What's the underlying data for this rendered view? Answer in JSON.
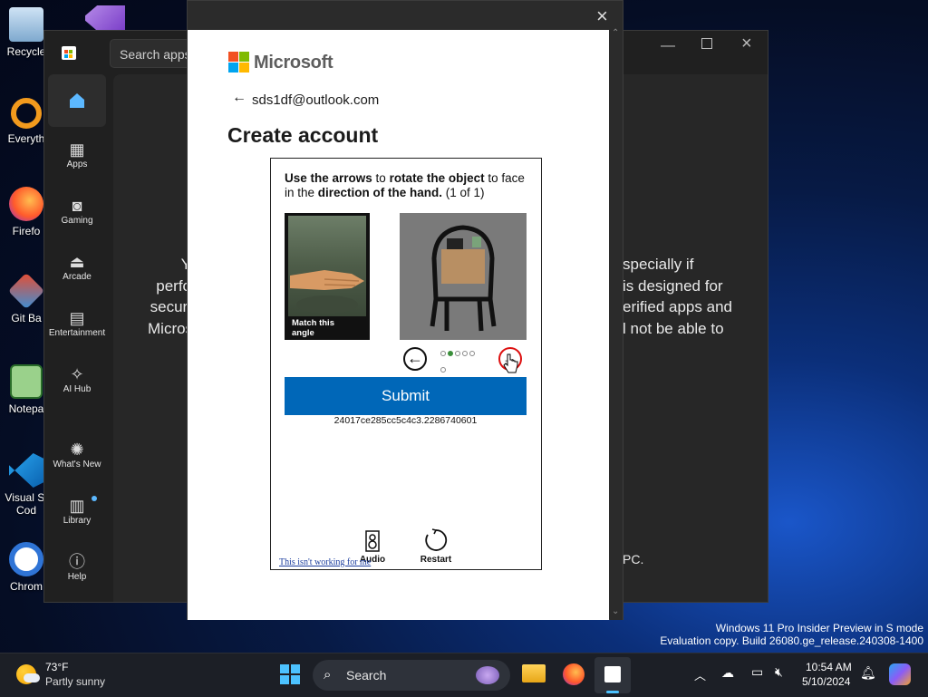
{
  "desktop": {
    "icons": [
      {
        "label": "Recycle",
        "name": "recycle-bin-icon"
      },
      {
        "label": "Everyth",
        "name": "everything-icon"
      },
      {
        "label": "Firefo",
        "name": "firefox-desktop-icon"
      },
      {
        "label": "Git Ba",
        "name": "git-bash-icon"
      },
      {
        "label": "Notepa",
        "name": "notepad-icon"
      },
      {
        "label": "Visual St\nCod",
        "name": "vscode-icon"
      },
      {
        "label": "Chrom",
        "name": "chrome-icon"
      }
    ],
    "watermark_line1": "Windows 11 Pro Insider Preview in S mode",
    "watermark_line2": "Evaluation copy. Build 26080.ge_release.240308-1400"
  },
  "store": {
    "search_placeholder": "Search apps,",
    "nav": [
      {
        "label": "",
        "icon": "home-icon"
      },
      {
        "label": "Apps",
        "icon": "apps-icon"
      },
      {
        "label": "Gaming",
        "icon": "gamepad-icon"
      },
      {
        "label": "Arcade",
        "icon": "joystick-icon"
      },
      {
        "label": "Entertainment",
        "icon": "clapperboard-icon"
      },
      {
        "label": "AI Hub",
        "icon": "sparkle-icon"
      },
      {
        "label": "What's New",
        "icon": "megaphone-icon"
      },
      {
        "label": "Library",
        "icon": "library-icon"
      },
      {
        "label": "Help",
        "icon": "help-icon"
      }
    ],
    "bg_left": [
      "Y",
      "perfo",
      "securi",
      "Micros"
    ],
    "bg_right": [
      "specially if",
      "is designed for",
      "erified apps and",
      "l not be able to"
    ],
    "bg_bottom_right": "PC."
  },
  "dialog": {
    "brand": "Microsoft",
    "email": "sds1df@outlook.com",
    "title": "Create account",
    "captcha": {
      "instr_bold1": "Use the arrows",
      "instr_t1": " to ",
      "instr_bold2": "rotate the object",
      "instr_t2": " to face in the ",
      "instr_bold3": "direction of the hand.",
      "instr_t3": " (1 of 1)",
      "ref_label": "Match this angle",
      "page_dots": [
        false,
        true,
        false,
        false,
        false,
        false
      ],
      "submit_label": "Submit",
      "session_id": "24017ce285cc5c4c3.2286740601",
      "audio_label": "Audio",
      "restart_label": "Restart",
      "not_working": "This isn't working for me"
    }
  },
  "taskbar": {
    "temp": "73°F",
    "weather": "Partly sunny",
    "search_label": "Search",
    "time": "10:54 AM",
    "date": "5/10/2024"
  }
}
